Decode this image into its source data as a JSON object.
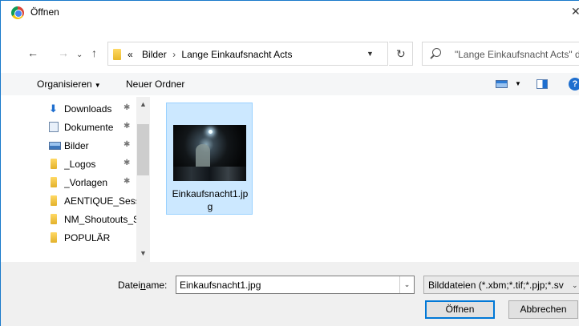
{
  "window": {
    "title": "Öffnen"
  },
  "navigation": {
    "breadcrumb": [
      "Bilder",
      "Lange Einkaufsnacht Acts"
    ],
    "breadcrumb_prefix": "«",
    "search_placeholder": "\"Lange Einkaufsnacht Acts\" d"
  },
  "toolbar": {
    "organize_label": "Organisieren",
    "new_folder_label": "Neuer Ordner"
  },
  "sidebar": {
    "items": [
      {
        "label": "Downloads",
        "icon": "download-icon",
        "pinned": true
      },
      {
        "label": "Dokumente",
        "icon": "document-icon",
        "pinned": true
      },
      {
        "label": "Bilder",
        "icon": "pictures-icon",
        "pinned": true
      },
      {
        "label": "_Logos",
        "icon": "folder-icon",
        "pinned": true
      },
      {
        "label": "_Vorlagen",
        "icon": "folder-icon",
        "pinned": true
      },
      {
        "label": "AENTIQUE_Sessions",
        "icon": "folder-icon",
        "pinned": false
      },
      {
        "label": "NM_Shoutouts_S",
        "icon": "folder-icon",
        "pinned": false
      },
      {
        "label": "POPULÄR",
        "icon": "folder-icon",
        "pinned": false
      }
    ]
  },
  "files": [
    {
      "name": "Einkaufsnacht1.jpg",
      "selected": true
    }
  ],
  "footer": {
    "filename_label_pre": "Datei",
    "filename_label_underlined": "n",
    "filename_label_post": "ame:",
    "filename_value": "Einkaufsnacht1.jpg",
    "filter_value": "Bilddateien (*.xbm;*.tif;*.pjp;*.sv",
    "open_label": "Öffnen",
    "cancel_label": "Abbrechen"
  },
  "colors": {
    "accent": "#0078d7",
    "selection": "#cce8ff",
    "window_border": "#1979ca"
  }
}
